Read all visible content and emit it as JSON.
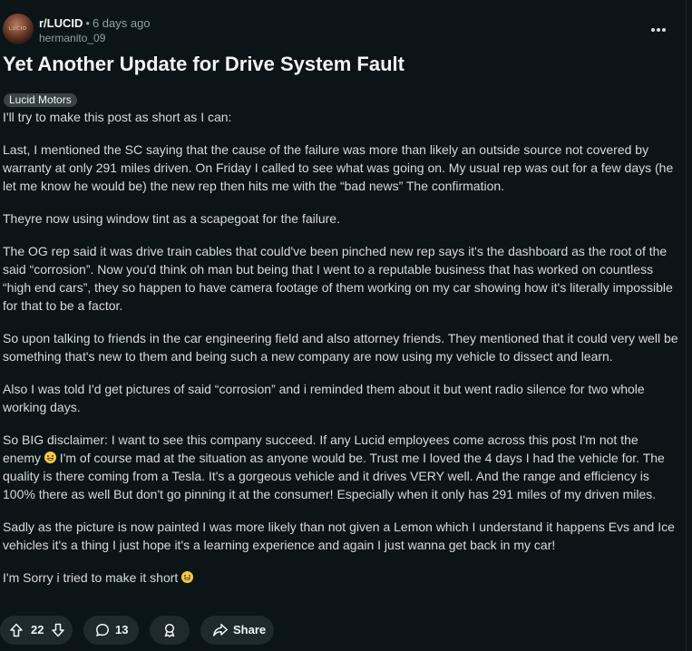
{
  "post": {
    "subreddit": "r/LUCID",
    "separator": "•",
    "time_ago": "6 days ago",
    "author": "hermanito_09",
    "avatar_text": "LUCID",
    "more_icon": "ellipsis-icon",
    "title": "Yet Another Update for Drive System Fault",
    "flair": "Lucid Motors",
    "paragraphs": [
      "I'll try to make this post as short as I can:",
      "Last, I mentioned the SC saying that the cause of the failure was more than likely an outside source not covered by warranty at only 291 miles driven. On Friday I called to see what was going on. My usual rep was out for a few days (he let me know he would be) the new rep then hits me with the “bad news” The confirmation.",
      "Theyre now using window tint as a scapegoat for the failure.",
      "The OG rep said it was drive train cables that could've been pinched new rep says it's the dashboard as the root of the said “corrosion”. Now you'd think oh man but being that I went to a reputable business that has worked on countless “high end cars”, they so happen to have camera footage of them working on my car showing how it's literally impossible for that to be a factor.",
      "So upon talking to friends in the car engineering field and also attorney friends. They mentioned that it could very well be something that's new to them and being such a new company are now using my vehicle to dissect and learn.",
      "Also I was told I'd get pictures of said “corrosion” and i reminded them about it but went radio silence for two whole working days."
    ],
    "para7_a": "So BIG disclaimer: I want to see this company succeed. If any Lucid employees come across this post I'm not the enemy ",
    "para7_b": " I'm of course mad at the situation as anyone would be. Trust me I loved the 4 days I had the vehicle for. The quality is there coming from a Tesla. It's a gorgeous vehicle and it drives VERY well. And the range and efficiency is 100% there as well But don't go pinning it at the consumer! Especially when it only has 291 miles of my driven miles.",
    "para8": "Sadly as the picture is now painted I was more likely than not given a Lemon which I understand it happens Evs and Ice vehicles it's a thing I just hope it's a learning experience and again I just wanna get back in my car!",
    "para9": "I'm Sorry i tried to make it short ",
    "emoji_name": "grinning-face-icon"
  },
  "actions": {
    "upvote_icon": "upvote-arrow-icon",
    "score": "22",
    "downvote_icon": "downvote-arrow-icon",
    "comment_icon": "comment-bubble-icon",
    "comment_count": "13",
    "award_icon": "award-icon",
    "share_icon": "share-arrow-icon",
    "share_label": "Share"
  },
  "colors": {
    "background": "#0b1416",
    "text": "#d7dadc",
    "muted": "#8ba2ad",
    "pill": "#1e2a2e",
    "flair": "#3a4245"
  }
}
